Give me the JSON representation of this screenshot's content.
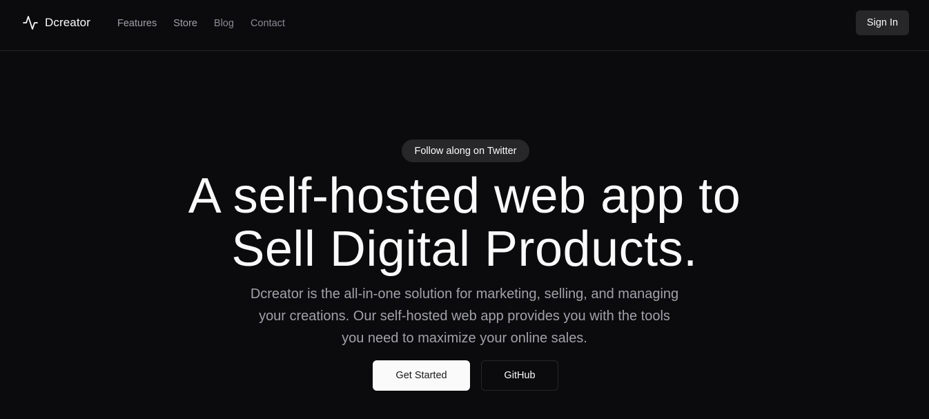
{
  "header": {
    "brand": {
      "name": "Dcreator",
      "icon": "activity-icon"
    },
    "nav": [
      {
        "label": "Features",
        "style": "strong"
      },
      {
        "label": "Store",
        "style": "strong"
      },
      {
        "label": "Blog",
        "style": "muted"
      },
      {
        "label": "Contact",
        "style": "muted"
      }
    ],
    "sign_in_label": "Sign In"
  },
  "hero": {
    "pill_label": "Follow along on Twitter",
    "headline": [
      "A self-hosted web app to",
      "Sell Digital Products."
    ],
    "subtext": [
      "Dcreator is the all-in-one solution for marketing, selling, and managing",
      "your creations. Our self-hosted web app provides you with the tools",
      "you need to maximize your online sales."
    ],
    "primary_cta": "Get Started",
    "secondary_cta": "GitHub"
  },
  "colors": {
    "background": "#0b0b0d",
    "border": "#27272a",
    "foreground": "#fafafa",
    "muted_text": "#a1a1aa",
    "button_secondary_bg": "#27272a"
  }
}
